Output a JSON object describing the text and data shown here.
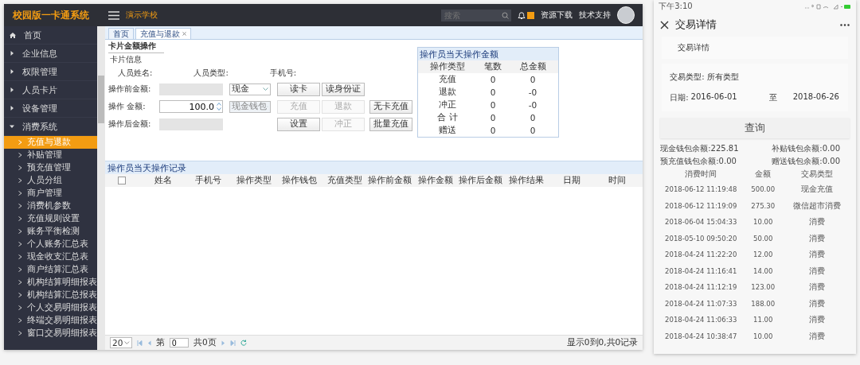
{
  "admin": {
    "logo": "校园版一卡通系统",
    "school": "演示学校",
    "search": {
      "placeholder": "搜索"
    },
    "header_links": [
      "资源下载",
      "技术支持"
    ],
    "sidebar": {
      "items": [
        {
          "label": "首页",
          "kind": "home"
        },
        {
          "label": "企业信息",
          "kind": "group",
          "expanded": false
        },
        {
          "label": "权限管理",
          "kind": "group",
          "expanded": false
        },
        {
          "label": "人员卡片",
          "kind": "group",
          "expanded": false
        },
        {
          "label": "设备管理",
          "kind": "group",
          "expanded": false
        },
        {
          "label": "消费系统",
          "kind": "group",
          "expanded": true,
          "children": [
            {
              "label": "充值与退款",
              "selected": true
            },
            {
              "label": "补贴管理",
              "selected": false
            },
            {
              "label": "预充值管理",
              "selected": false
            },
            {
              "label": "人员分组",
              "selected": false
            },
            {
              "label": "商户管理",
              "selected": false
            },
            {
              "label": "消费机参数",
              "selected": false
            },
            {
              "label": "充值规则设置",
              "selected": false
            },
            {
              "label": "账务平衡检测",
              "selected": false
            },
            {
              "label": "个人账务汇总表",
              "selected": false
            },
            {
              "label": "现金收支汇总表",
              "selected": false
            },
            {
              "label": "商户结算汇总表",
              "selected": false
            },
            {
              "label": "机构结算明细报表",
              "selected": false
            },
            {
              "label": "机构结算汇总报表",
              "selected": false
            },
            {
              "label": "个人交易明细报表",
              "selected": false
            },
            {
              "label": "终端交易明细报表",
              "selected": false
            },
            {
              "label": "窗口交易明细报表",
              "selected": false
            }
          ]
        }
      ]
    },
    "tabs": [
      {
        "label": "首页",
        "selected": false,
        "closable": false
      },
      {
        "label": "充值与退款",
        "selected": true,
        "closable": true
      }
    ],
    "card_panel": {
      "title": "卡片金额操作",
      "section": "卡片信息",
      "info_labels": [
        "人员姓名:",
        "人员类型:",
        "手机号:"
      ],
      "rows": [
        {
          "label": "操作前金额:",
          "field": {
            "kind": "readonly"
          },
          "select": {
            "value": "现金",
            "disabled": false
          },
          "buttons": [
            {
              "label": "读卡",
              "disabled": false
            },
            {
              "label": "读身份证",
              "disabled": false
            }
          ]
        },
        {
          "label": "操作  金额:",
          "field": {
            "kind": "number",
            "value": "100.0"
          },
          "select": {
            "value": "现金钱包",
            "disabled": true
          },
          "buttons": [
            {
              "label": "充值",
              "disabled": true
            },
            {
              "label": "退款",
              "disabled": true
            },
            {
              "label": "无卡充值",
              "disabled": false
            }
          ]
        },
        {
          "label": "操作后金额:",
          "field": {
            "kind": "readonly"
          },
          "buttons": [
            {
              "label": "设置",
              "disabled": false
            },
            {
              "label": "冲正",
              "disabled": true
            },
            {
              "label": "批量充值",
              "disabled": false
            }
          ]
        }
      ]
    },
    "summary": {
      "title": "操作员当天操作金额",
      "columns": [
        "操作类型",
        "笔数",
        "总金额"
      ],
      "rows": [
        [
          "充值",
          "0",
          "0"
        ],
        [
          "退款",
          "0",
          "-0"
        ],
        [
          "冲正",
          "0",
          "-0"
        ],
        [
          "合 计",
          "0",
          "0"
        ],
        [
          "赠送",
          "0",
          "0"
        ]
      ]
    },
    "records": {
      "title": "操作员当天操作记录",
      "select_all_checked": false,
      "columns": [
        "姓名",
        "手机号",
        "操作类型",
        "操作钱包",
        "充值类型",
        "操作前金额",
        "操作金额",
        "操作后金额",
        "操作结果",
        "日期",
        "时间"
      ]
    },
    "pager": {
      "page_size": "20",
      "page_label": "第",
      "page_value": "0",
      "total_pages": "共0页",
      "info": "显示0到0,共0记录"
    }
  },
  "phone": {
    "status_time": "下午3:10",
    "title": "交易详情",
    "card_title": "交易详情",
    "type_line": "交易类型: 所有类型",
    "date_label": "日期:",
    "date_from": "2016-06-01",
    "date_sep": "至",
    "date_to": "2018-06-26",
    "query_button": "查询",
    "balances": [
      "现金钱包余额:225.81",
      "补贴钱包余额:0.00",
      "预充值钱包余额:0.00",
      "赠送钱包余额:0.00"
    ],
    "columns": [
      "消费时间",
      "金额",
      "交易类型"
    ],
    "rows": [
      [
        "2018-06-12 11:19:48",
        "500.00",
        "现金充值"
      ],
      [
        "2018-06-12 11:19:09",
        "275.30",
        "微信超市消费"
      ],
      [
        "2018-06-04 15:04:33",
        "10.00",
        "消费"
      ],
      [
        "2018-05-10 09:50:20",
        "50.00",
        "消费"
      ],
      [
        "2018-04-24 11:22:20",
        "12.00",
        "消费"
      ],
      [
        "2018-04-24 11:16:41",
        "14.00",
        "消费"
      ],
      [
        "2018-04-24 11:12:19",
        "123.00",
        "消费"
      ],
      [
        "2018-04-24 11:07:33",
        "188.00",
        "消费"
      ],
      [
        "2018-04-24 11:06:33",
        "11.00",
        "消费"
      ],
      [
        "2018-04-24 10:38:47",
        "10.00",
        "消费"
      ]
    ]
  }
}
